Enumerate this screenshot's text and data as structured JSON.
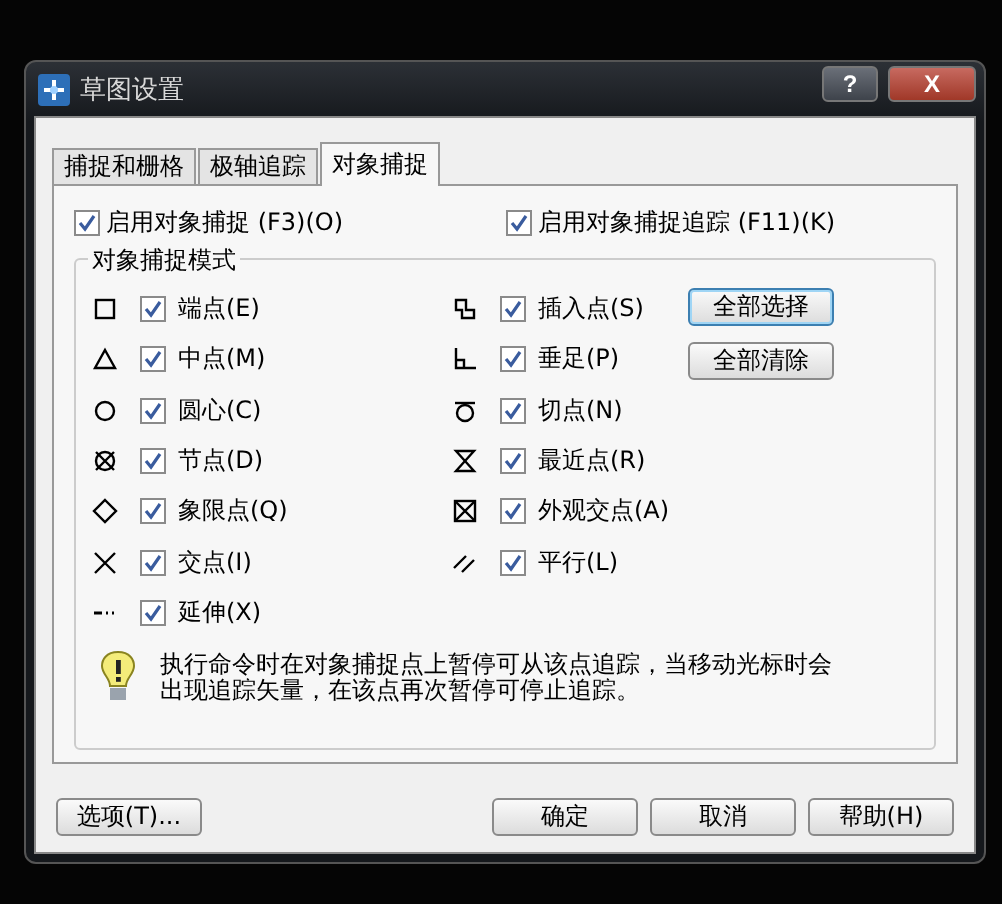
{
  "window": {
    "title": "草图设置",
    "controls": [
      "?",
      "X"
    ]
  },
  "tabs": [
    {
      "label": "捕捉和栅格",
      "selected": false
    },
    {
      "label": "极轴追踪",
      "selected": false
    },
    {
      "label": "对象捕捉",
      "selected": true
    }
  ],
  "enable": [
    {
      "label": "启用对象捕捉 (F3)(O)",
      "checked": true
    },
    {
      "label": "启用对象捕捉追踪 (F11)(K)",
      "checked": true
    }
  ],
  "group_title": "对象捕捉模式",
  "left_column": [
    {
      "label": "端点(E)",
      "checked": true
    },
    {
      "label": "中点(M)",
      "checked": true
    },
    {
      "label": "圆心(C)",
      "checked": true
    },
    {
      "label": "节点(D)",
      "checked": true
    },
    {
      "label": "象限点(Q)",
      "checked": true
    },
    {
      "label": "交点(I)",
      "checked": true
    },
    {
      "label": "延伸(X)",
      "checked": true
    }
  ],
  "right_column": [
    {
      "label": "插入点(S)",
      "checked": true
    },
    {
      "label": "垂足(P)",
      "checked": true
    },
    {
      "label": "切点(N)",
      "checked": true
    },
    {
      "label": "最近点(R)",
      "checked": true
    },
    {
      "label": "外观交点(A)",
      "checked": true
    },
    {
      "label": "平行(L)",
      "checked": true
    }
  ],
  "side_buttons": [
    {
      "label": "全部选择",
      "selected": true
    },
    {
      "label": "全部清除",
      "selected": false
    }
  ],
  "hint": "执行命令时在对象捕捉点上暂停可从该点追踪，当移动光标时会出现追踪矢量，在该点再次暂停可停止追踪。",
  "footer_left": "选项(T)...",
  "footer_buttons": [
    "确定",
    "取消",
    "帮助(H)"
  ]
}
